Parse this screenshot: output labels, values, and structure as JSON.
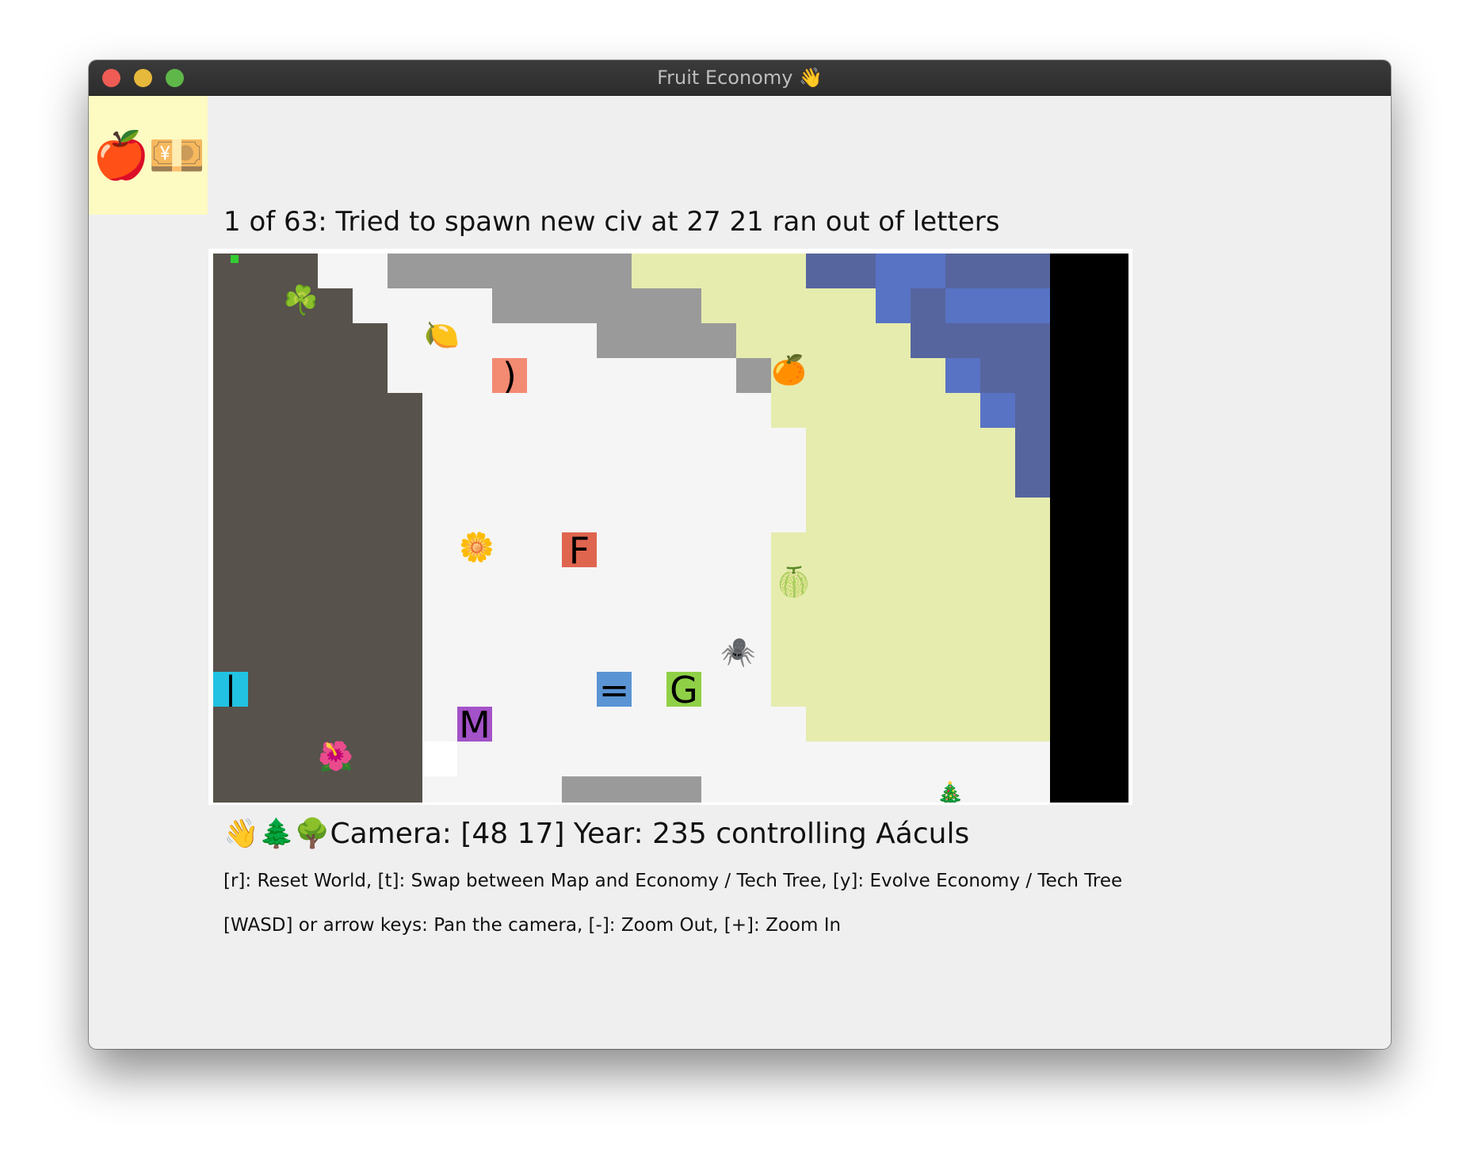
{
  "window": {
    "title": "Fruit Economy 👋"
  },
  "logo": {
    "text": "🍎💴"
  },
  "status": {
    "message": "1 of 63: Tried to spawn new civ at 27 21 ran out of letters"
  },
  "map": {
    "colors": {
      "dark": "#57524b",
      "light": "#f5f5f5",
      "gray": "#9a9a9a",
      "grass": "#e6ecae",
      "water": "#5873c4",
      "water_dark": "#56659e",
      "void": "#000000",
      "white": "#ffffff",
      "marker": "#33cc33"
    },
    "grid": [
      "dddlllggggggghhhhhwwxxxvv",
      "dddlllllggggghhhhhhwxxxvv",
      "ddddlllllggggghhhhhwwwwvv",
      "ddddlllllllllghhhhhhhxwwvv",
      "ddddddlllllllllhhhhhhhhxwvv",
      "ddddddlllllllllhhhhhhhhhhwvv",
      "ddddddlllllllllllhhhhhhhhwvv",
      "ddddddlllllllllllhhhhhhhhhhvv",
      "ddddddllllllllllhhhhhhhhhhhvv",
      "ddddddllllllllllhhhhhhhhhhhvv",
      "ddddddllllllllllhhhhhhhhhhhvv",
      "ddddddllllllllllhhhhhhhhhhhvv",
      "ddddddlllllllllllllhhhhhhhhvv",
      "ddddddlllllllllllllhhhhhhhhvv",
      "ddddddlllllllllllllhhhhhhhhvv",
      "ddddddLlllllllllllllllllllllvv",
      "ddddddlllllggggllllllllllllvv"
    ],
    "icons": [
      {
        "name": "clover-icon",
        "glyph": "☘️"
      },
      {
        "name": "lemon-icon",
        "glyph": "🍋"
      },
      {
        "name": "tangerine-icon",
        "glyph": "🍊"
      },
      {
        "name": "sunflower-icon",
        "glyph": "🌼"
      },
      {
        "name": "melon-icon",
        "glyph": "🍈"
      },
      {
        "name": "spider-icon",
        "glyph": "🕷️"
      },
      {
        "name": "hibiscus-icon",
        "glyph": "🌺"
      },
      {
        "name": "christmas-tree-icon",
        "glyph": "🎄"
      }
    ],
    "civs": [
      {
        "letter": ")",
        "color": "#f38a72"
      },
      {
        "letter": "F",
        "color": "#e0654f"
      },
      {
        "letter": "|",
        "color": "#22c2e2"
      },
      {
        "letter": "=",
        "color": "#5a94d4"
      },
      {
        "letter": "G",
        "color": "#8fd046"
      },
      {
        "letter": "M",
        "color": "#a352c8"
      }
    ]
  },
  "camera": {
    "icons": "👋🌲🌳",
    "text": "Camera: [48 17] Year: 235 controlling Aáculs"
  },
  "help": {
    "line1": "[r]: Reset World, [t]: Swap between Map and Economy / Tech Tree, [y]: Evolve Economy / Tech Tree",
    "line2": "[WASD] or arrow keys: Pan the camera, [-]: Zoom Out, [+]: Zoom In"
  }
}
